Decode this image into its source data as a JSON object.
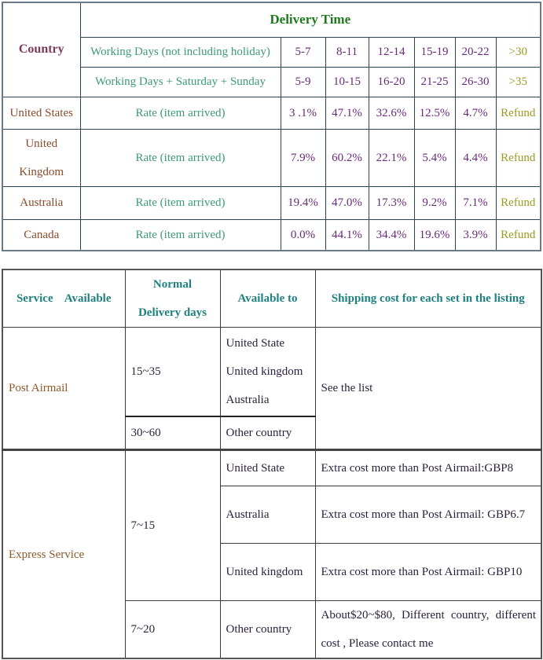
{
  "delivery_table": {
    "title": "Delivery Time",
    "country_header": "Country",
    "row_labels": {
      "working_days": "Working Days (not including holiday)",
      "working_days_weekend": "Working Days + Saturday + Sunday"
    },
    "working_days_ranges": [
      "5-7",
      "8-11",
      "12-14",
      "15-19",
      "20-22",
      ">30"
    ],
    "weekend_ranges": [
      "5-9",
      "10-15",
      "16-20",
      "21-25",
      "26-30",
      ">35"
    ],
    "rows": [
      {
        "country": "United States",
        "label": "Rate (item arrived)",
        "values": [
          "3 .1%",
          "47.1%",
          "32.6%",
          "12.5%",
          "4.7%",
          "Refund"
        ]
      },
      {
        "country": "United Kingdom",
        "label": "Rate (item arrived)",
        "values": [
          "7.9%",
          "60.2%",
          "22.1%",
          "5.4%",
          "4.4%",
          "Refund"
        ]
      },
      {
        "country": "Australia",
        "label": "Rate (item arrived)",
        "values": [
          "19.4%",
          "47.0%",
          "17.3%",
          "9.2%",
          "7.1%",
          "Refund"
        ]
      },
      {
        "country": "Canada",
        "label": "Rate (item arrived)",
        "values": [
          "0.0%",
          "44.1%",
          "34.4%",
          "19.6%",
          "3.9%",
          "Refund"
        ]
      }
    ]
  },
  "service_table": {
    "headers": {
      "service": "Service    Available",
      "normal_days_line1": "Normal",
      "normal_days_line2": "Delivery days",
      "available_to": "Available to",
      "shipping_cost": "Shipping cost for each set in the listing"
    },
    "post_airmail": {
      "name": "Post Airmail",
      "group1_days": "15~35",
      "group1_countries": [
        "United State",
        "United kingdom",
        "Australia"
      ],
      "group2_days": "30~60",
      "group2_country": "Other country",
      "cost": "See the list"
    },
    "express": {
      "name": "Express Service",
      "group1_days": "7~15",
      "rows": [
        {
          "country": "United State",
          "cost": "Extra cost more than Post Airmail:GBP8"
        },
        {
          "country": "Australia",
          "cost": "Extra cost more than Post Airmail: GBP6.7"
        },
        {
          "country": "United kingdom",
          "cost": "Extra cost more than Post Airmail: GBP10"
        }
      ],
      "group2_days": "7~20",
      "group2_country": "Other country",
      "group2_cost": "About$20~$80, Different country, different cost , Please contact me"
    }
  }
}
